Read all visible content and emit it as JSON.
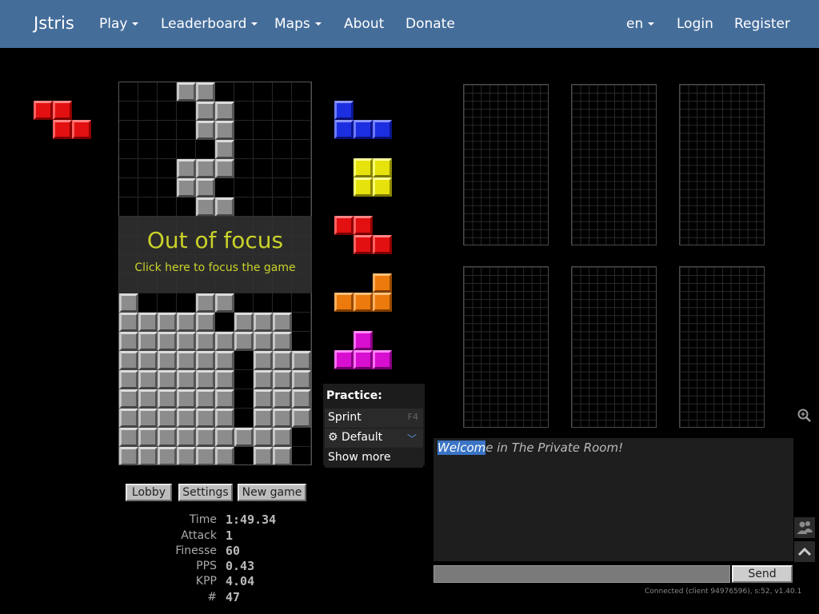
{
  "nav": {
    "brand": "Jstris",
    "items": [
      "Play",
      "Leaderboard",
      "Maps",
      "About",
      "Donate"
    ],
    "lang": "en",
    "login": "Login",
    "register": "Register"
  },
  "overlay": {
    "title": "Out of focus",
    "subtitle": "Click here to focus the game"
  },
  "practice": {
    "heading": "Practice:",
    "sprint": "Sprint",
    "sprint_key": "F4",
    "default": "Default",
    "show_more": "Show more"
  },
  "buttons": {
    "lobby": "Lobby",
    "settings": "Settings",
    "new_game": "New game"
  },
  "stats": [
    {
      "label": "Time",
      "value": "1:49.34"
    },
    {
      "label": "Attack",
      "value": "1"
    },
    {
      "label": "Finesse",
      "value": "60"
    },
    {
      "label": "PPS",
      "value": "0.43"
    },
    {
      "label": "KPP",
      "value": "4.04"
    },
    {
      "label": "#",
      "value": "47"
    }
  ],
  "chat": {
    "welcome_highlight": "Welcom",
    "welcome_rest": "e in The Private Room!",
    "send": "Send",
    "status": "Connected (client 94976596), s:52, v1.40.1"
  },
  "pieces": {
    "hold": "Z",
    "queue": [
      "J",
      "O",
      "Z",
      "L",
      "T"
    ]
  },
  "colors": {
    "navbar": "#456d9a",
    "overlay_text": "#c9d22a",
    "Z": "#e21010",
    "J": "#1c2fe0",
    "O": "#e6e20c",
    "L": "#ec7a0c",
    "T": "#d80fd0",
    "garbage": "#8c8c8c"
  },
  "board": {
    "columns": 10,
    "rows": 20,
    "cells": [
      "...##.....",
      "....##....",
      "....##....",
      ".....#....",
      "...###....",
      "...##.....",
      "....##....",
      "..........",
      "..........",
      "..........",
      "..........",
      "#...##....",
      "#####.###.",
      "#########.",
      "######.###",
      "######.###",
      "######.###",
      "######.###",
      "#########.",
      "######.##."
    ]
  }
}
